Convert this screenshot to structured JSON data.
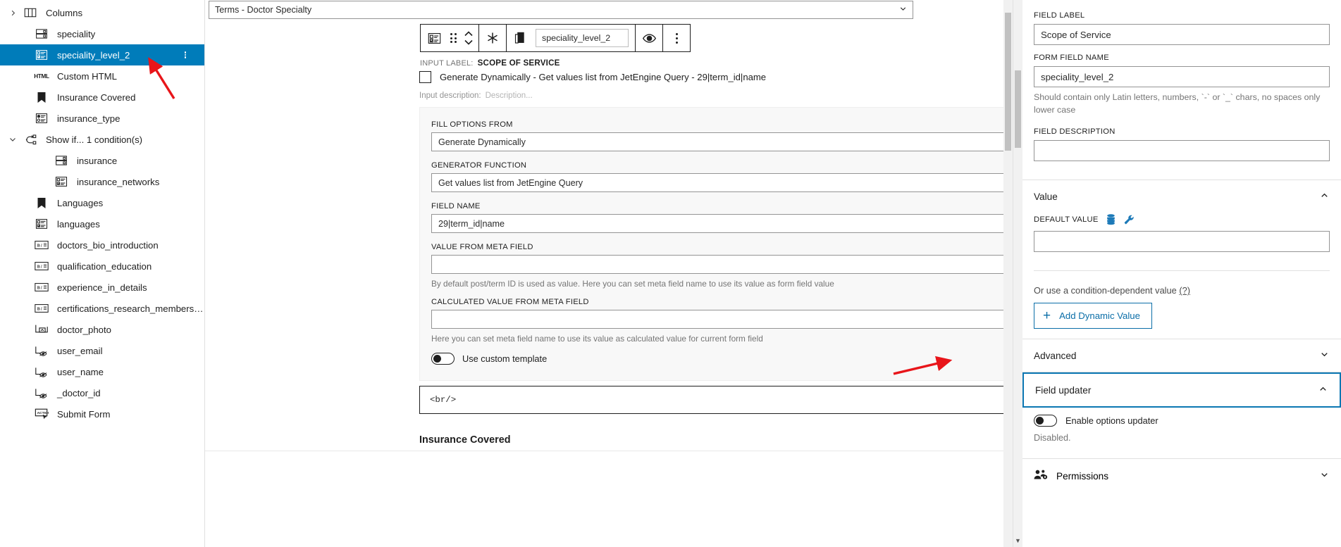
{
  "sidebar": {
    "items": [
      {
        "label": "Columns",
        "icon": "columns-icon",
        "indent": 0,
        "chevron": "right",
        "selected": false
      },
      {
        "label": "speciality",
        "icon": "radio-field-icon",
        "indent": 1,
        "chevron": "",
        "selected": false
      },
      {
        "label": "speciality_level_2",
        "icon": "checkbox-field-icon",
        "indent": 1,
        "chevron": "",
        "selected": true
      },
      {
        "label": "Custom HTML",
        "icon": "html-icon",
        "indent": 1,
        "chevron": "",
        "selected": false
      },
      {
        "label": "Insurance Covered",
        "icon": "bookmark-icon",
        "indent": 1,
        "chevron": "",
        "selected": false
      },
      {
        "label": "insurance_type",
        "icon": "radio-list-icon",
        "indent": 1,
        "chevron": "",
        "selected": false
      },
      {
        "label": "Show if... 1 condition(s)",
        "icon": "condition-icon",
        "indent": 0,
        "chevron": "down",
        "selected": false
      },
      {
        "label": "insurance",
        "icon": "radio-field-icon",
        "indent": 2,
        "chevron": "",
        "selected": false
      },
      {
        "label": "insurance_networks",
        "icon": "checkbox-field-icon",
        "indent": 2,
        "chevron": "",
        "selected": false
      },
      {
        "label": "Languages",
        "icon": "bookmark-icon",
        "indent": 1,
        "chevron": "",
        "selected": false
      },
      {
        "label": "languages",
        "icon": "checkbox-field-icon",
        "indent": 1,
        "chevron": "",
        "selected": false
      },
      {
        "label": "doctors_bio_introduction",
        "icon": "wysiwyg-icon",
        "indent": 1,
        "chevron": "",
        "selected": false
      },
      {
        "label": "qualification_education",
        "icon": "wysiwyg-icon",
        "indent": 1,
        "chevron": "",
        "selected": false
      },
      {
        "label": "experience_in_details",
        "icon": "wysiwyg-icon",
        "indent": 1,
        "chevron": "",
        "selected": false
      },
      {
        "label": "certifications_research_membership",
        "icon": "wysiwyg-icon",
        "indent": 1,
        "chevron": "",
        "selected": false
      },
      {
        "label": "doctor_photo",
        "icon": "media-field-icon",
        "indent": 1,
        "chevron": "",
        "selected": false
      },
      {
        "label": "user_email",
        "icon": "hidden-field-icon",
        "indent": 1,
        "chevron": "",
        "selected": false
      },
      {
        "label": "user_name",
        "icon": "hidden-field-icon",
        "indent": 1,
        "chevron": "",
        "selected": false
      },
      {
        "label": "_doctor_id",
        "icon": "hidden-field-icon",
        "indent": 1,
        "chevron": "",
        "selected": false
      },
      {
        "label": "Submit Form",
        "icon": "action-icon",
        "indent": 1,
        "chevron": "",
        "selected": false
      }
    ]
  },
  "canvas": {
    "term_select_value": "Terms - Doctor Specialty",
    "toolbar": {
      "block_type_icon": "checkbox-field-icon",
      "drag_handle_icon": "drag-dots-icon",
      "move_icon": "move-up-down-icon",
      "asterisk_icon": "required-asterisk-icon",
      "copy_icon": "duplicate-icon",
      "field_name_value": "speciality_level_2",
      "preview_icon": "eye-icon",
      "more_icon": "more-options-icon"
    },
    "input_label_prefix": "INPUT LABEL:",
    "input_label_value": "SCOPE OF SERVICE",
    "generate_dynamically_checkbox_label": "Generate Dynamically - Get values list from JetEngine Query - 29|term_id|name",
    "input_description_prefix": "Input description:",
    "input_description_placeholder": "Description...",
    "settings": {
      "fill_options_from_label": "FILL OPTIONS FROM",
      "fill_options_from_value": "Generate Dynamically",
      "generator_function_label": "GENERATOR FUNCTION",
      "generator_function_value": "Get values list from JetEngine Query",
      "field_name_label": "FIELD NAME",
      "field_name_value": "29|term_id|name",
      "value_from_meta_label": "VALUE FROM META FIELD",
      "value_from_meta_value": "",
      "value_from_meta_help": "By default post/term ID is used as value. Here you can set meta field name to use its value as form field value",
      "calculated_value_label": "CALCULATED VALUE FROM META FIELD",
      "calculated_value_value": "",
      "calculated_value_help": "Here you can set meta field name to use its value as calculated value for current form field",
      "use_custom_template_label": "Use custom template"
    },
    "html_block_content": "<br/>",
    "next_block_heading": "Insurance Covered"
  },
  "inspector": {
    "field_label_label": "FIELD LABEL",
    "field_label_value": "Scope of Service",
    "form_field_name_label": "FORM FIELD NAME",
    "form_field_name_value": "speciality_level_2",
    "form_field_name_help": "Should contain only Latin letters, numbers, `-` or `_` chars, no spaces only lower case",
    "field_description_label": "FIELD DESCRIPTION",
    "field_description_value": "",
    "value_panel": {
      "title": "Value",
      "collapse_icon": "chevron-up-icon",
      "default_value_label": "DEFAULT VALUE",
      "database_icon": "database-icon",
      "wrench_icon": "wrench-icon",
      "default_value_value": "",
      "condition_note": "Or use a condition-dependent value",
      "condition_help_link": "(?)",
      "add_dynamic_value_label": "Add Dynamic Value"
    },
    "advanced_panel": {
      "title": "Advanced",
      "expand_icon": "chevron-down-icon"
    },
    "field_updater_panel": {
      "title": "Field updater",
      "collapse_icon": "chevron-up-icon",
      "enable_options_updater_label": "Enable options updater",
      "status": "Disabled."
    },
    "permissions_panel": {
      "title": "Permissions",
      "icon": "permissions-users-icon",
      "expand_icon": "chevron-down-icon"
    }
  },
  "colors": {
    "selection_blue": "#007cba",
    "accent_outline": "#0b77b3",
    "annotation_red": "#e8151a",
    "link_blue": "#1d7ab8"
  }
}
